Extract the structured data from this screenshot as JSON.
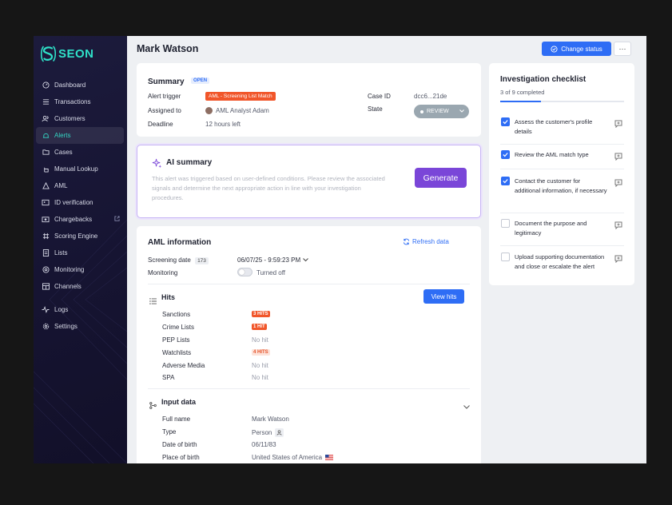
{
  "brand": {
    "name": "SEON"
  },
  "sidebar": {
    "items": [
      {
        "label": "Dashboard",
        "icon": "dashboard-icon"
      },
      {
        "label": "Transactions",
        "icon": "list-icon"
      },
      {
        "label": "Customers",
        "icon": "users-icon"
      },
      {
        "label": "Alerts",
        "icon": "alert-icon",
        "active": true
      },
      {
        "label": "Cases",
        "icon": "folder-icon"
      },
      {
        "label": "Manual Lookup",
        "icon": "hand-icon"
      },
      {
        "label": "AML",
        "icon": "warning-icon"
      },
      {
        "label": "ID verification",
        "icon": "id-card-icon"
      },
      {
        "label": "Chargebacks",
        "icon": "camera-icon",
        "external": true
      },
      {
        "label": "Scoring Engine",
        "icon": "hash-icon"
      },
      {
        "label": "Lists",
        "icon": "document-icon"
      },
      {
        "label": "Monitoring",
        "icon": "monitoring-icon"
      },
      {
        "label": "Channels",
        "icon": "channels-icon"
      },
      {
        "label": "Logs",
        "icon": "pulse-icon"
      },
      {
        "label": "Settings",
        "icon": "gear-icon"
      }
    ]
  },
  "header": {
    "title": "Mark Watson",
    "change_status": "Change status",
    "more": "···"
  },
  "summary": {
    "title": "Summary",
    "badge": "OPEN",
    "alert_trigger_label": "Alert trigger",
    "alert_trigger_value": "AML - Screening List Match",
    "assigned_label": "Assigned to",
    "assigned_value": "AML Analyst Adam",
    "deadline_label": "Deadline",
    "deadline_value": "12 hours left",
    "case_id_label": "Case ID",
    "case_id_value": "dcc6...21de",
    "state_label": "State",
    "state_value": "REVIEW"
  },
  "ai_summary": {
    "title": "AI summary",
    "text": "This alert was triggered based on user-defined conditions. Please review the associated signals and determine the next appropriate action in line with your investigation procedures.",
    "button": "Generate"
  },
  "aml": {
    "title": "AML information",
    "refresh": "Refresh data",
    "screening_label": "Screening date",
    "screening_count": "173",
    "screening_value": "06/07/25 - 9:59:23 PM",
    "monitoring_label": "Monitoring",
    "monitoring_value": "Turned off",
    "hits_title": "Hits",
    "view_hits": "View hits",
    "hits": [
      {
        "name": "Sanctions",
        "value": "3 HITS",
        "kind": "red"
      },
      {
        "name": "Crime Lists",
        "value": "1 HIT",
        "kind": "red"
      },
      {
        "name": "PEP Lists",
        "value": "No hit",
        "kind": "none"
      },
      {
        "name": "Watchlists",
        "value": "4 HITS",
        "kind": "light"
      },
      {
        "name": "Adverse Media",
        "value": "No hit",
        "kind": "none"
      },
      {
        "name": "SPA",
        "value": "No hit",
        "kind": "none"
      }
    ],
    "input_title": "Input data",
    "input_rows": [
      {
        "label": "Full name",
        "value": "Mark Watson"
      },
      {
        "label": "Type",
        "value": "Person"
      },
      {
        "label": "Date of birth",
        "value": "06/11/83"
      },
      {
        "label": "Place of birth",
        "value": "United States of America"
      }
    ]
  },
  "checklist": {
    "title": "Investigation checklist",
    "progress_text": "3 of 9 completed",
    "progress_fraction": 0.33,
    "items": [
      {
        "text": "Assess the customer's profile details",
        "checked": true
      },
      {
        "text": "Review the AML match type",
        "checked": true
      },
      {
        "text": "Contact the customer for additional information, if necessary",
        "checked": true
      },
      {
        "text": "Document the purpose and legitimacy",
        "checked": false
      },
      {
        "text": "Upload supporting documentation and close or escalate the alert",
        "checked": false
      }
    ]
  }
}
